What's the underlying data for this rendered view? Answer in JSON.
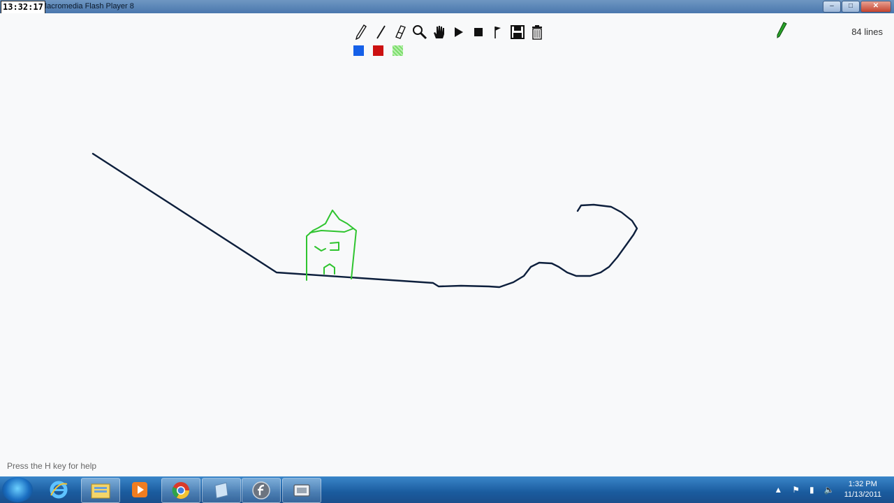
{
  "window": {
    "title": "Macromedia Flash Player 8",
    "clock_overlay": "13:32:17",
    "controls": [
      "minimize",
      "maximize",
      "close"
    ]
  },
  "toolbar": {
    "tools": [
      "pencil-icon",
      "line-icon",
      "eraser-icon",
      "zoom-icon",
      "hand-icon",
      "play-icon",
      "stop-icon",
      "flag-icon",
      "save-icon",
      "trash-icon"
    ],
    "colors": [
      "#1560e8",
      "#cc1111",
      "#7bdc6a"
    ]
  },
  "status": {
    "line_count": "84 lines",
    "help_text": "Press the H key for help"
  },
  "drawing": {
    "track_color": "#0d1f3c",
    "house_color": "#2fc42f"
  },
  "taskbar": {
    "apps": [
      "start-orb",
      "internet-explorer",
      "windows-explorer",
      "media-player",
      "chrome",
      "notepad",
      "flash-player",
      "screen-recorder"
    ],
    "clock_time": "1:32 PM",
    "clock_date": "11/13/2011"
  }
}
